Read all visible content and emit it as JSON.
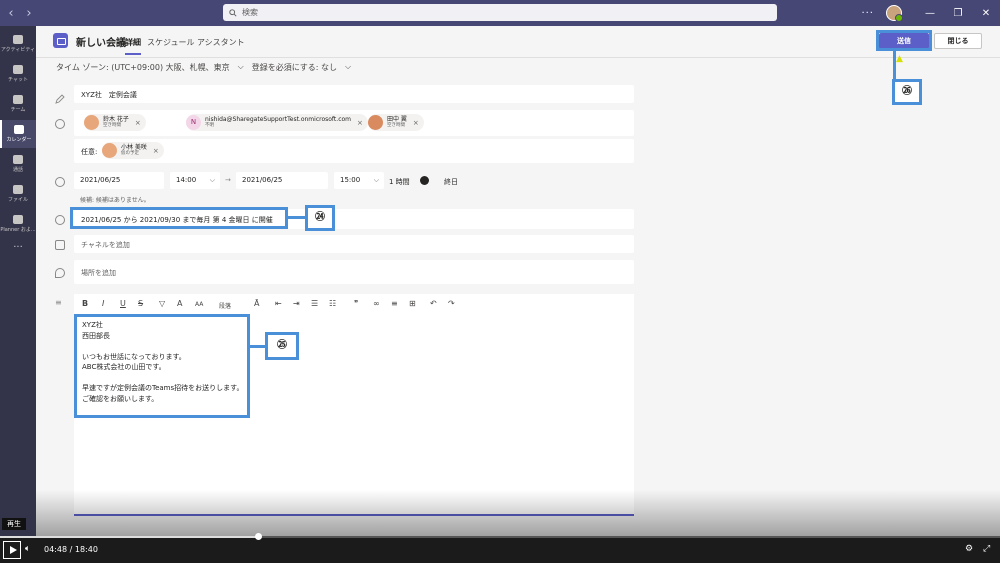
{
  "topbar": {
    "search_placeholder": "検索",
    "more": "···"
  },
  "rail": {
    "items": [
      {
        "label": "アクティビティ",
        "icon": "bell-icon"
      },
      {
        "label": "チャット",
        "icon": "chat-icon"
      },
      {
        "label": "チーム",
        "icon": "teams-icon"
      },
      {
        "label": "カレンダー",
        "icon": "calendar-icon",
        "active": true
      },
      {
        "label": "通話",
        "icon": "phone-icon"
      },
      {
        "label": "ファイル",
        "icon": "file-icon"
      },
      {
        "label": "Planner およ...",
        "icon": "planner-icon"
      }
    ],
    "more": "···"
  },
  "header": {
    "title": "新しい会議",
    "tab_details": "詳細",
    "tab_assistant": "スケジュール アシスタント",
    "send": "送信",
    "close": "閉じる"
  },
  "subbar": {
    "timezone": "タイム ゾーン: (UTC+09:00) 大阪、札幌、東京",
    "registration": "登録を必須にする: なし"
  },
  "form": {
    "title_value": "XYZ社　定例会議",
    "required_attendees": [
      {
        "name": "鈴木 花子",
        "status": "空き時間"
      },
      {
        "initial": "N",
        "name": "nishida@SharegateSupportTest.onmicrosoft.com",
        "status": "不明"
      },
      {
        "name": "田中 翼",
        "status": "空き時間"
      }
    ],
    "optional_label": "任意:",
    "optional_attendees": [
      {
        "name": "小林 美咲",
        "status": "仮の予定"
      }
    ],
    "start_date": "2021/06/25",
    "start_time": "14:00",
    "end_date": "2021/06/25",
    "end_time": "15:00",
    "duration": "1 時間",
    "allday": "終日",
    "suggestion": "候補: 候補はありません。",
    "recurrence": "2021/06/25 から 2021/09/30 まで毎月 第 4 金曜日 に開催",
    "channel_placeholder": "チャネルを追加",
    "location_placeholder": "場所を追加",
    "toolbar_paragraph": "段落",
    "body_lines": [
      "XYZ社",
      "西田部長",
      "",
      "いつもお世話になっております。",
      "ABC株式会社の山田です。",
      "",
      "早速ですが定例会議のTeams招待をお送りします。",
      "ご確認をお願いします。"
    ]
  },
  "annotations": {
    "a24": "㉔",
    "a25": "㉕",
    "a26": "㉖"
  },
  "player": {
    "label": "再生",
    "current": "04:48",
    "sep": "/",
    "total": "18:40",
    "progress": 0.258
  }
}
